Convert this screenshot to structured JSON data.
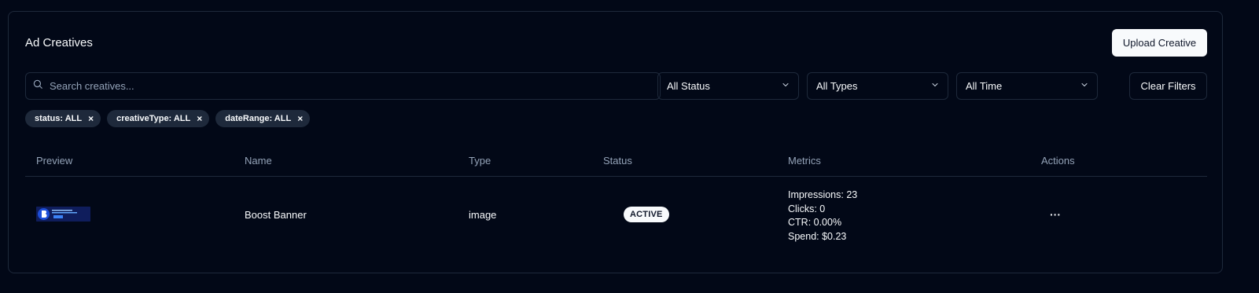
{
  "page": {
    "title": "Ad Creatives",
    "upload_label": "Upload Creative"
  },
  "filters": {
    "search_placeholder": "Search creatives...",
    "search_value": "",
    "status_selected": "All Status",
    "type_selected": "All Types",
    "time_selected": "All Time",
    "clear_label": "Clear Filters"
  },
  "active_filters": [
    {
      "label": "status: ALL",
      "remove": "×"
    },
    {
      "label": "creativeType: ALL",
      "remove": "×"
    },
    {
      "label": "dateRange: ALL",
      "remove": "×"
    }
  ],
  "table": {
    "columns": [
      "Preview",
      "Name",
      "Type",
      "Status",
      "Metrics",
      "Actions"
    ],
    "rows": [
      {
        "name": "Boost Banner",
        "type": "image",
        "status": "ACTIVE",
        "metrics": {
          "impressions": "Impressions: 23",
          "clicks": "Clicks: 0",
          "ctr": "CTR: 0.00%",
          "spend": "Spend: $0.23"
        },
        "actions_label": "···"
      }
    ]
  },
  "icons": {
    "search": "search-icon",
    "chevron": "chevron-down-icon",
    "actions": "more-horizontal-icon"
  },
  "colors": {
    "background": "#020817",
    "border": "#1e293b",
    "muted_text": "#94a3b8",
    "foreground": "#f8fafc",
    "chip_bg": "#1e293b",
    "preview_bg": "#0f1d5c",
    "preview_logo": "#1d4ed8"
  }
}
